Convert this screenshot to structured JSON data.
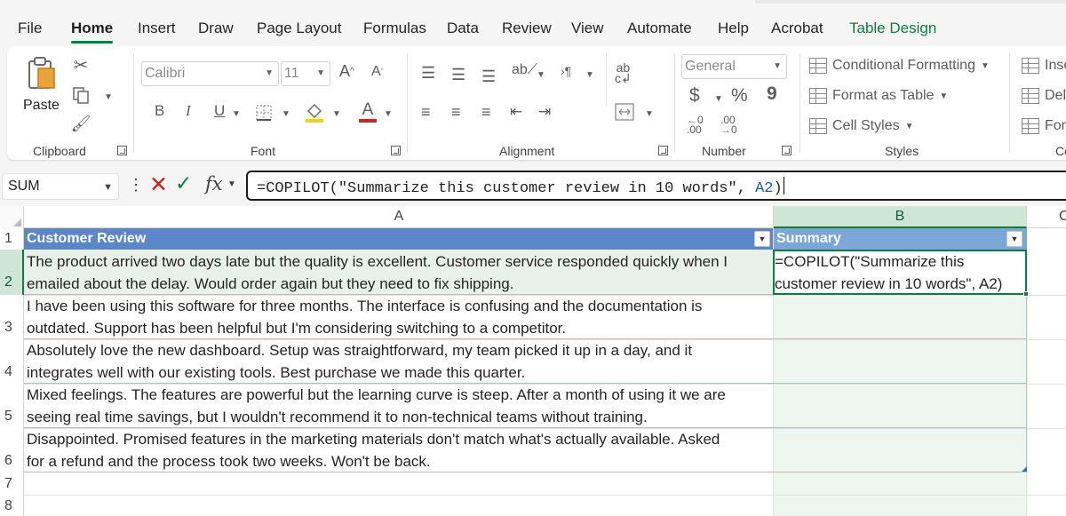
{
  "menu": {
    "tabs": [
      {
        "label": "File"
      },
      {
        "label": "Home"
      },
      {
        "label": "Insert"
      },
      {
        "label": "Draw"
      },
      {
        "label": "Page Layout"
      },
      {
        "label": "Formulas"
      },
      {
        "label": "Data"
      },
      {
        "label": "Review"
      },
      {
        "label": "View"
      },
      {
        "label": "Automate"
      },
      {
        "label": "Help"
      },
      {
        "label": "Acrobat"
      },
      {
        "label": "Table Design"
      }
    ],
    "active_tab": "Home",
    "context_tab_color": "#107c41"
  },
  "ribbon": {
    "clipboard": {
      "paste_label": "Paste",
      "group_label": "Clipboard"
    },
    "font": {
      "font_name": "Calibri",
      "font_size": "11",
      "group_label": "Font",
      "bold": "B",
      "italic": "I",
      "underline": "U"
    },
    "alignment": {
      "group_label": "Alignment"
    },
    "number": {
      "format": "General",
      "currency": "$",
      "percent": "%",
      "comma": "9",
      "group_label": "Number"
    },
    "styles": {
      "conditional_formatting": "Conditional Formatting",
      "format_as_table": "Format as Table",
      "cell_styles": "Cell Styles",
      "group_label": "Styles"
    },
    "cells": {
      "insert": "Inse",
      "delete": "Dele",
      "format": "For",
      "group_label": "Ce"
    }
  },
  "formula_bar": {
    "name_box": "SUM",
    "fx": "fx",
    "formula_prefix": "=COPILOT(\"Summarize this customer review in 10 words\", ",
    "formula_ref": "A2",
    "formula_suffix": ")"
  },
  "sheet": {
    "columns": [
      "A",
      "B",
      "C"
    ],
    "selected_column": "B",
    "rows": [
      "1",
      "2",
      "3",
      "4",
      "5",
      "6",
      "7",
      "8"
    ],
    "selected_row": "2",
    "table_header_color": "#5b86c8",
    "headers": {
      "a": "Customer Review",
      "b": "Summary"
    },
    "reviews": [
      {
        "line1": "The product arrived two days late but the quality is excellent. Customer service responded quickly when I",
        "line2": "emailed about the delay. Would order again but they need to fix shipping."
      },
      {
        "line1": "I have been using this software for three months. The interface is confusing and the documentation is",
        "line2": "outdated. Support has been helpful but I'm considering switching to a competitor."
      },
      {
        "line1": "Absolutely love the new dashboard. Setup was straightforward, my team picked it up in a day, and it",
        "line2": "integrates well with our existing tools. Best purchase we made this quarter."
      },
      {
        "line1": "Mixed feelings. The features are powerful but the learning curve is steep. After a month of using it we are",
        "line2": "seeing real time savings, but I wouldn't recommend it to non-technical teams without training."
      },
      {
        "line1": "Disappointed. Promised features in the marketing materials don't match what's actually available. Asked",
        "line2": "for a refund and the process took two weeks. Won't be back."
      }
    ],
    "active_cell": {
      "line1": "=COPILOT(\"Summarize this",
      "line2": "customer review in 10 words\", A2)"
    }
  }
}
